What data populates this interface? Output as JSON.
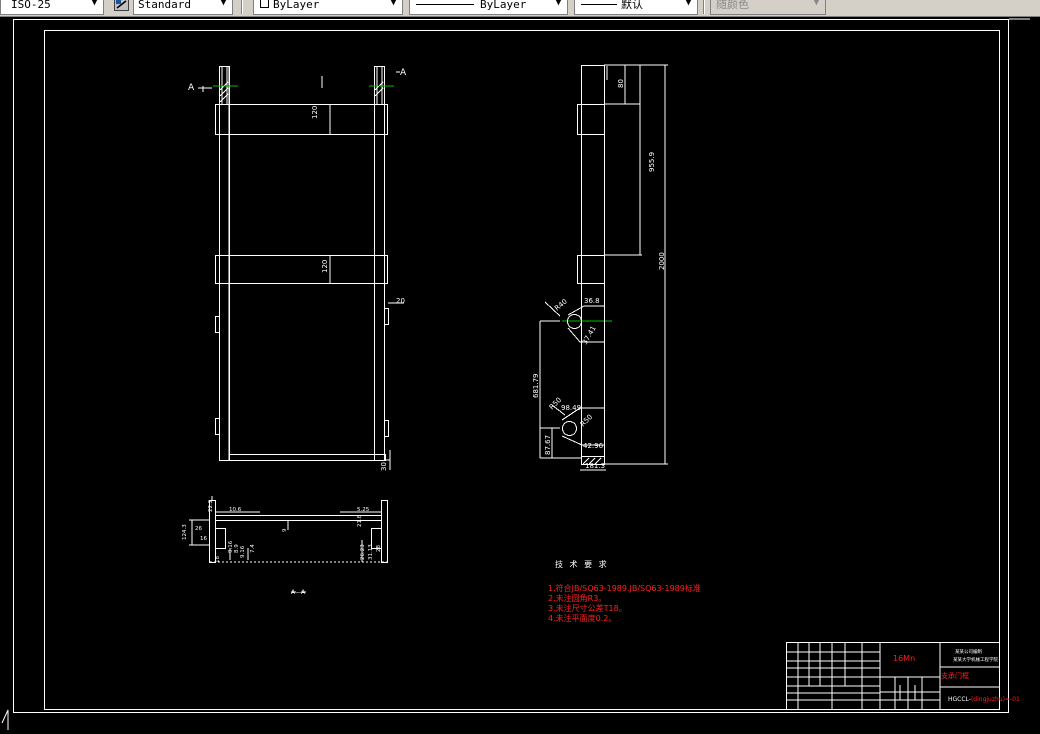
{
  "toolbar": {
    "dimstyle": "ISO-25",
    "textstyle": "Standard",
    "layer": "ByLayer",
    "linetype": "ByLayer",
    "lineweight": "默认",
    "plotstyle": "随颜色"
  },
  "drawing": {
    "section_marks": {
      "a_left": "A",
      "a_right": "A",
      "section_label": "A—A"
    },
    "front_dims": [
      "120",
      "120",
      "20",
      "30"
    ],
    "side_dims": [
      "80",
      "955.9",
      "2000",
      "36.8",
      "R40",
      "37.41",
      "681.79",
      "98.49",
      "R50",
      "42.96",
      "87.67",
      "181.3",
      "R50"
    ],
    "section_dims": [
      "10.6",
      "5.25",
      "22.2",
      "124.3",
      "26",
      "16",
      "18",
      "9.16",
      "9.16",
      "7.4",
      "8.9",
      "9",
      "21.8",
      "26.23",
      "31.13",
      "28"
    ],
    "tech_title": "技 术 要 求",
    "tech_notes": [
      "1.符合JB/SQ63-1989.JB/SQ63-1989标准",
      "2.未注圆角R3。",
      "3.未注尺寸公差T18。",
      "4.未注平面度0.2。"
    ],
    "title_block": {
      "material": "16Mn",
      "company_lines": [
        "某某公司编制",
        "某某大学机械工程学院"
      ],
      "part_name": "支承门框",
      "code_prefix": "HGCCL-",
      "code_suffix": "(dingjuzhu)=-01"
    }
  }
}
